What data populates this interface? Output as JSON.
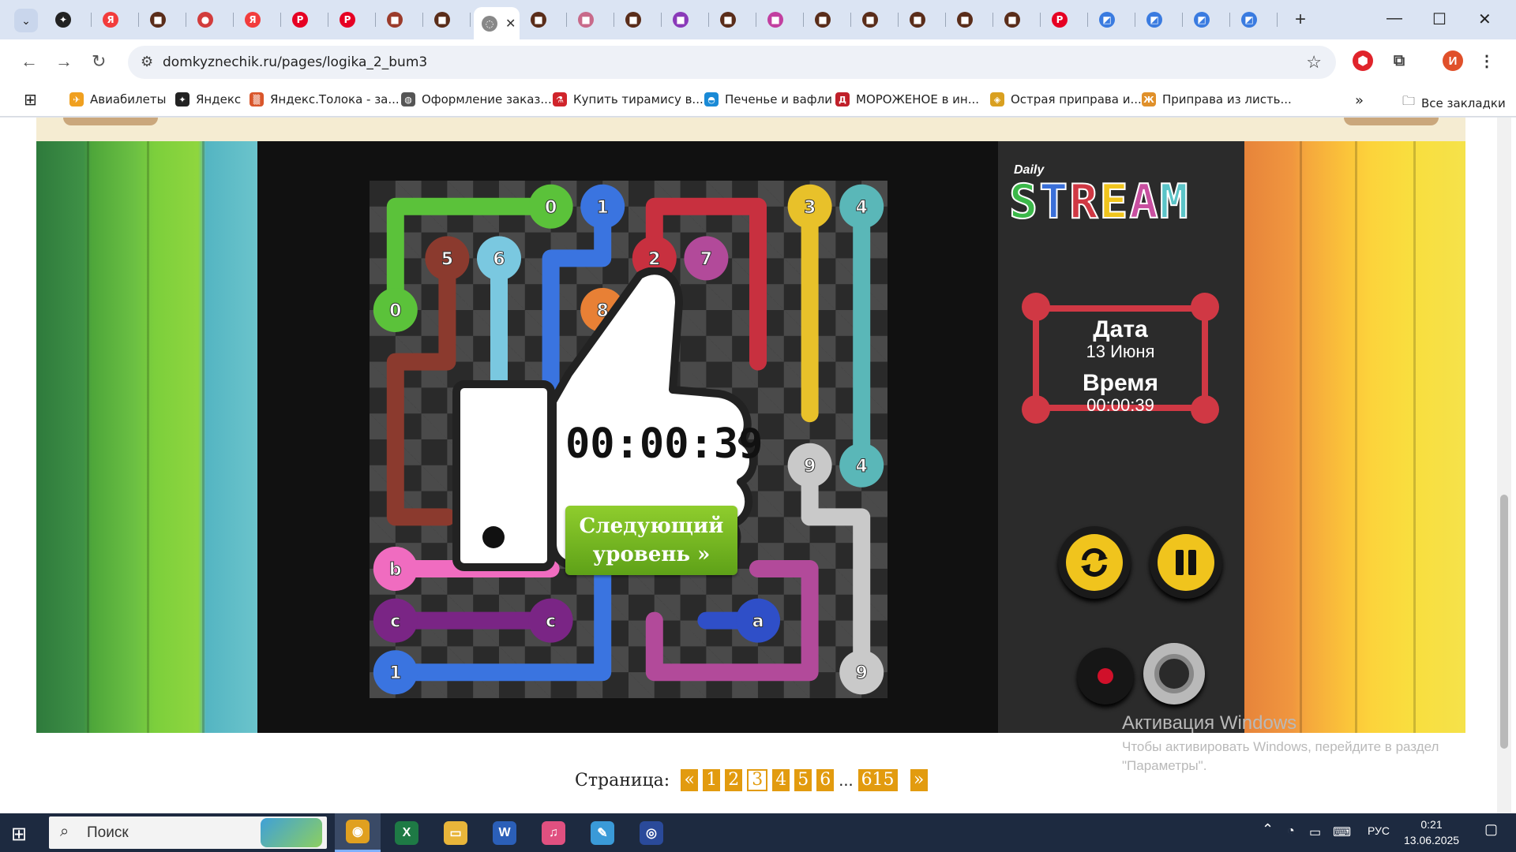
{
  "browser": {
    "tabs": [
      {
        "icon": "star-icon",
        "color": "#222222",
        "glyph": "✦"
      },
      {
        "icon": "yandex-icon",
        "color": "#f23c3c",
        "glyph": "Я"
      },
      {
        "icon": "game-icon",
        "color": "#5a2d1a",
        "glyph": "■"
      },
      {
        "icon": "record-icon",
        "color": "#d23c3c",
        "glyph": "●"
      },
      {
        "icon": "yandex-icon",
        "color": "#f23c3c",
        "glyph": "Я"
      },
      {
        "icon": "pinterest-icon",
        "color": "#e60023",
        "glyph": "P"
      },
      {
        "icon": "pinterest-icon",
        "color": "#e60023",
        "glyph": "P"
      },
      {
        "icon": "image-icon",
        "color": "#9b3b2b",
        "glyph": "■"
      },
      {
        "icon": "game-icon",
        "color": "#5a2d1a",
        "glyph": "■"
      },
      {
        "icon": "loading-icon",
        "color": "#888888",
        "glyph": "◌",
        "active": true
      },
      {
        "icon": "game-icon",
        "color": "#5a2d1a",
        "glyph": "■"
      },
      {
        "icon": "image-icon",
        "color": "#c86a8a",
        "glyph": "■"
      },
      {
        "icon": "game-icon",
        "color": "#5a2d1a",
        "glyph": "■"
      },
      {
        "icon": "grid-icon",
        "color": "#8a3ab9",
        "glyph": "■"
      },
      {
        "icon": "game-icon",
        "color": "#5a2d1a",
        "glyph": "■"
      },
      {
        "icon": "image-icon",
        "color": "#c23fa0",
        "glyph": "■"
      },
      {
        "icon": "game-icon",
        "color": "#5a2d1a",
        "glyph": "■"
      },
      {
        "icon": "game-icon",
        "color": "#5a2d1a",
        "glyph": "■"
      },
      {
        "icon": "game-icon",
        "color": "#5a2d1a",
        "glyph": "■"
      },
      {
        "icon": "game-icon",
        "color": "#5a2d1a",
        "glyph": "■"
      },
      {
        "icon": "game-icon",
        "color": "#5a2d1a",
        "glyph": "■"
      },
      {
        "icon": "pinterest-icon",
        "color": "#e60023",
        "glyph": "P"
      },
      {
        "icon": "blue-app-icon",
        "color": "#3a7be0",
        "glyph": "◩"
      },
      {
        "icon": "blue-app-icon",
        "color": "#3a7be0",
        "glyph": "◩"
      },
      {
        "icon": "blue-app-icon",
        "color": "#3a7be0",
        "glyph": "◩"
      },
      {
        "icon": "blue-app-icon",
        "color": "#3a7be0",
        "glyph": "◩"
      }
    ],
    "url": "domkyznechik.ru/pages/logika_2_bum3",
    "profile_initial": "И",
    "bookmarks": [
      {
        "label": "Авиабилеты",
        "color": "#f0a020",
        "glyph": "✈"
      },
      {
        "label": "Яндекс",
        "color": "#222222",
        "glyph": "✦"
      },
      {
        "label": "Яндекс.Толока - за...",
        "color": "#d9562b",
        "glyph": "▒"
      },
      {
        "label": "Оформление заказ...",
        "color": "#555555",
        "glyph": "◍"
      },
      {
        "label": "Купить тирамису в...",
        "color": "#d0242b",
        "glyph": "⚗"
      },
      {
        "label": "Печенье и вафли",
        "color": "#1a8ad6",
        "glyph": "◓"
      },
      {
        "label": "МОРОЖЕНОЕ в ин...",
        "color": "#c0202a",
        "glyph": "Д"
      },
      {
        "label": "Острая приправа и...",
        "color": "#d9a020",
        "glyph": "◈"
      },
      {
        "label": "Приправа из листь...",
        "color": "#e0902a",
        "glyph": "Ж"
      }
    ],
    "all_bookmarks": "Все закладки"
  },
  "game": {
    "logo_small": "Daily",
    "logo_letters": [
      {
        "ch": "S",
        "color": "#3cb84a"
      },
      {
        "ch": "T",
        "color": "#3a6fd8"
      },
      {
        "ch": "R",
        "color": "#d03844"
      },
      {
        "ch": "E",
        "color": "#f0c41d"
      },
      {
        "ch": "A",
        "color": "#c84fa0"
      },
      {
        "ch": "M",
        "color": "#5bc4c8"
      }
    ],
    "date_label": "Дата",
    "date_value": "13 Июня",
    "time_label": "Время",
    "time_value": "00:00:39",
    "overlay_timer": "00:00:39",
    "next_level_line1": "Следующий",
    "next_level_line2": "уровень »",
    "nodes": [
      {
        "label": "0",
        "color": "#5bc23a",
        "col": 3,
        "row": 0
      },
      {
        "label": "1",
        "color": "#3a74e0",
        "col": 4,
        "row": 0
      },
      {
        "label": "3",
        "color": "#e8c12a",
        "col": 8,
        "row": 0
      },
      {
        "label": "4",
        "color": "#5ab7b8",
        "col": 9,
        "row": 0
      },
      {
        "label": "5",
        "color": "#8b3a2e",
        "col": 1,
        "row": 1
      },
      {
        "label": "6",
        "color": "#7ac8e0",
        "col": 2,
        "row": 1
      },
      {
        "label": "2",
        "color": "#c8303f",
        "col": 5,
        "row": 1
      },
      {
        "label": "7",
        "color": "#b24a9a",
        "col": 6,
        "row": 1
      },
      {
        "label": "0",
        "color": "#5bc23a",
        "col": 0,
        "row": 2
      },
      {
        "label": "8",
        "color": "#e88035",
        "col": 4,
        "row": 2
      },
      {
        "label": "9",
        "color": "#c9c9c9",
        "col": 8,
        "row": 5
      },
      {
        "label": "4",
        "color": "#5ab7b8",
        "col": 9,
        "row": 5
      },
      {
        "label": "b",
        "color": "#f06cc0",
        "col": 0,
        "row": 7
      },
      {
        "label": "c",
        "color": "#7a2585",
        "col": 0,
        "row": 8
      },
      {
        "label": "c",
        "color": "#7a2585",
        "col": 3,
        "row": 8
      },
      {
        "label": "a",
        "color": "#2f4fc8",
        "col": 7,
        "row": 8
      },
      {
        "label": "1",
        "color": "#3a74e0",
        "col": 0,
        "row": 9
      },
      {
        "label": "9",
        "color": "#c9c9c9",
        "col": 9,
        "row": 9
      }
    ],
    "paths": [
      {
        "color": "#5bc23a",
        "cells": [
          [
            0,
            2
          ],
          [
            0,
            0
          ],
          [
            3,
            0
          ]
        ]
      },
      {
        "color": "#8b3a2e",
        "cells": [
          [
            1,
            1
          ],
          [
            1,
            3
          ],
          [
            0,
            3
          ],
          [
            0,
            6
          ],
          [
            1,
            6
          ]
        ]
      },
      {
        "color": "#7ac8e0",
        "cells": [
          [
            2,
            1
          ],
          [
            2,
            4
          ]
        ]
      },
      {
        "color": "#3a74e0",
        "cells": [
          [
            4,
            0
          ],
          [
            4,
            1
          ],
          [
            3,
            1
          ],
          [
            3,
            4
          ]
        ]
      },
      {
        "color": "#3a74e0",
        "cells": [
          [
            0,
            9
          ],
          [
            4,
            9
          ],
          [
            4,
            7
          ]
        ]
      },
      {
        "color": "#c8303f",
        "cells": [
          [
            5,
            1
          ],
          [
            5,
            0
          ],
          [
            7,
            0
          ],
          [
            7,
            3
          ]
        ]
      },
      {
        "color": "#e8c12a",
        "cells": [
          [
            8,
            0
          ],
          [
            8,
            4
          ]
        ]
      },
      {
        "color": "#5ab7b8",
        "cells": [
          [
            9,
            0
          ],
          [
            9,
            5
          ]
        ]
      },
      {
        "color": "#c9c9c9",
        "cells": [
          [
            8,
            5
          ],
          [
            8,
            6
          ],
          [
            9,
            6
          ],
          [
            9,
            9
          ]
        ]
      },
      {
        "color": "#f06cc0",
        "cells": [
          [
            0,
            7
          ],
          [
            3,
            7
          ]
        ]
      },
      {
        "color": "#7a2585",
        "cells": [
          [
            0,
            8
          ],
          [
            3,
            8
          ]
        ]
      },
      {
        "color": "#b24a9a",
        "cells": [
          [
            5,
            8
          ],
          [
            5,
            9
          ],
          [
            8,
            9
          ],
          [
            8,
            7
          ],
          [
            7,
            7
          ]
        ]
      },
      {
        "color": "#2f4fc8",
        "cells": [
          [
            6,
            8
          ],
          [
            7,
            8
          ]
        ]
      }
    ]
  },
  "activation": {
    "title": "Активация Windows",
    "subtitle_line1": "Чтобы активировать Windows, перейдите в раздел",
    "subtitle_line2": "\"Параметры\"."
  },
  "pager": {
    "label": "Страница:",
    "prev": "«",
    "pages": [
      "1",
      "2",
      "3",
      "4",
      "5",
      "6"
    ],
    "current": "3",
    "ellipsis": "...",
    "last": "615",
    "next": "»"
  },
  "taskbar": {
    "search_placeholder": "Поиск",
    "apps": [
      {
        "name": "chrome",
        "color": "#e0a020",
        "glyph": "◉",
        "active": true
      },
      {
        "name": "excel",
        "color": "#1e7a45",
        "glyph": "X"
      },
      {
        "name": "explorer",
        "color": "#e8b53a",
        "glyph": "▭"
      },
      {
        "name": "word",
        "color": "#2b5fb8",
        "glyph": "W"
      },
      {
        "name": "itunes",
        "color": "#e05080",
        "glyph": "♫"
      },
      {
        "name": "paint",
        "color": "#3a9ad8",
        "glyph": "✎"
      },
      {
        "name": "app",
        "color": "#2a4a9a",
        "glyph": "◎"
      }
    ],
    "language": "РУС",
    "time": "0:21",
    "date": "13.06.2025"
  }
}
